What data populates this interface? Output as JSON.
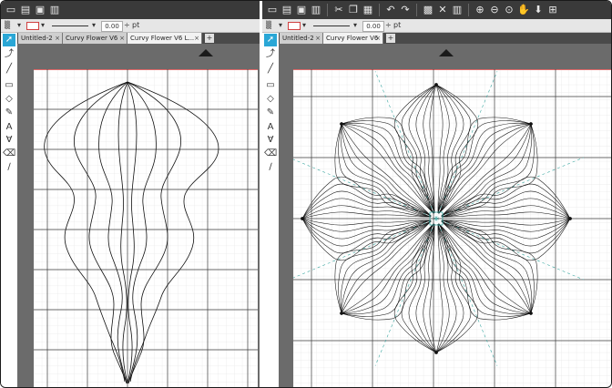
{
  "left": {
    "tabs": [
      {
        "label": "Untitled-2",
        "close": "×"
      },
      {
        "label": "Curvy Flower V6",
        "close": "×"
      },
      {
        "label": "Curvy Flower V6 L...",
        "close": "×"
      }
    ],
    "add_tab": "+",
    "stroke_value": "0.00",
    "stroke_unit": "pt"
  },
  "right": {
    "tabs": [
      {
        "label": "Untitled-2",
        "close": "×"
      },
      {
        "label": "Curvy Flower V6",
        "close": "×"
      }
    ],
    "add_tab": "+",
    "stroke_value": "0.00",
    "stroke_unit": "pt"
  },
  "icons": {
    "up_arrow": "up-arrow-icon",
    "selector": "pointer-icon"
  },
  "colors": {
    "tool_selected": "#2aa7d6",
    "grid_minor": "#dedede",
    "grid_major": "#3a3a3a",
    "mat_edge": "#e06a6a",
    "guide": "#3aa6a0"
  }
}
